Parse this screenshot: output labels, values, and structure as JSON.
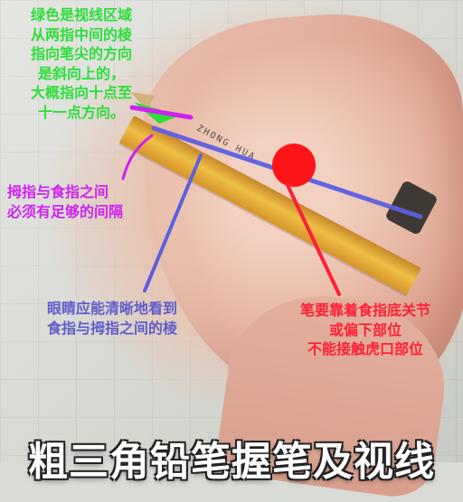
{
  "caption": {
    "green_text": "绿色是视线区域\n从两指中间的棱\n指向笔尖的方向\n是斜向上的，\n大概指向十点至\n十一点方向。",
    "magenta_text": "拇指与食指之间\n必须有足够的间隔",
    "blue_text": "眼睛应能清晰地看到\n食指与拇指之间的棱",
    "red_text": "笔要靠着食指底关节\n或偏下部位\n不能接触虎口部位",
    "title": "粗三角铅笔握笔及视线"
  },
  "pencil": {
    "imprint": "ZHONG HUA"
  },
  "colors": {
    "green": "#2bde39",
    "magenta": "#cd22f0",
    "blue": "#5f5ccc",
    "red": "#ff1f35"
  }
}
